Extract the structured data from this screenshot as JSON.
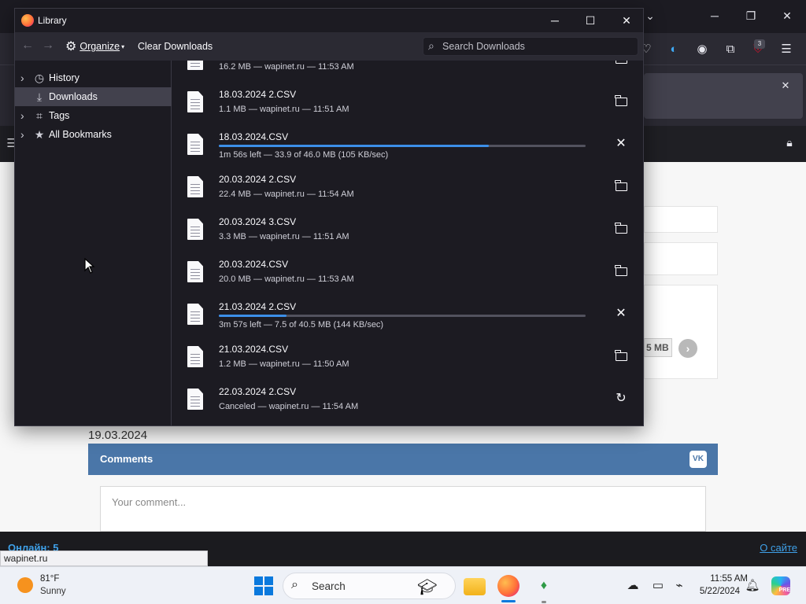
{
  "library": {
    "title": "Library",
    "toolbar": {
      "organize_label": "Organize",
      "clear_label": "Clear Downloads",
      "search_placeholder": "Search Downloads"
    },
    "sidebar": [
      {
        "label": "History",
        "icon": "clock-icon",
        "expandable": true,
        "selected": false
      },
      {
        "label": "Downloads",
        "icon": "download-icon",
        "expandable": false,
        "selected": true
      },
      {
        "label": "Tags",
        "icon": "tag-icon",
        "expandable": true,
        "selected": false
      },
      {
        "label": "All Bookmarks",
        "icon": "star-icon",
        "expandable": true,
        "selected": false
      }
    ],
    "downloads": [
      {
        "name": "",
        "status": "16.2 MB — wapinet.ru — 11:53 AM",
        "state": "done",
        "action": "folder-icon"
      },
      {
        "name": "18.03.2024 2.CSV",
        "status": "1.1 MB — wapinet.ru — 11:51 AM",
        "state": "done",
        "action": "folder-icon"
      },
      {
        "name": "18.03.2024.CSV",
        "status": "1m 56s left — 33.9 of 46.0 MB (105 KB/sec)",
        "state": "active",
        "progress": 0.737,
        "action": "cancel-icon"
      },
      {
        "name": "20.03.2024 2.CSV",
        "status": "22.4 MB — wapinet.ru — 11:54 AM",
        "state": "done",
        "action": "folder-icon"
      },
      {
        "name": "20.03.2024 3.CSV",
        "status": "3.3 MB — wapinet.ru — 11:51 AM",
        "state": "done",
        "action": "folder-icon"
      },
      {
        "name": "20.03.2024.CSV",
        "status": "20.0 MB — wapinet.ru — 11:53 AM",
        "state": "done",
        "action": "folder-icon"
      },
      {
        "name": "21.03.2024 2.CSV",
        "status": "3m 57s left — 7.5 of 40.5 MB (144 KB/sec)",
        "state": "active",
        "progress": 0.185,
        "action": "cancel-icon"
      },
      {
        "name": "21.03.2024.CSV",
        "status": "1.2 MB — wapinet.ru — 11:50 AM",
        "state": "done",
        "action": "folder-icon"
      },
      {
        "name": "22.03.2024 2.CSV",
        "status": "Canceled — wapinet.ru — 11:54 AM",
        "state": "canceled",
        "action": "retry-icon"
      }
    ]
  },
  "page": {
    "size_chip": "5 MB",
    "post_date": "19.03.2024",
    "comments_title": "Comments",
    "comment_placeholder": "Your comment...",
    "online_text": "Онлайн: 5",
    "about_link": "О сайте",
    "status_url": "wapinet.ru",
    "extension_badge": "3"
  },
  "taskbar": {
    "weather_temp": "81°F",
    "weather_condition": "Sunny",
    "search_label": "Search",
    "time": "11:55 AM",
    "date": "5/22/2024",
    "pre_badge": "PRE"
  },
  "colors": {
    "accent": "#3c8fe8",
    "library_bg": "#1c1b22",
    "comments_header": "#4a76a8"
  }
}
